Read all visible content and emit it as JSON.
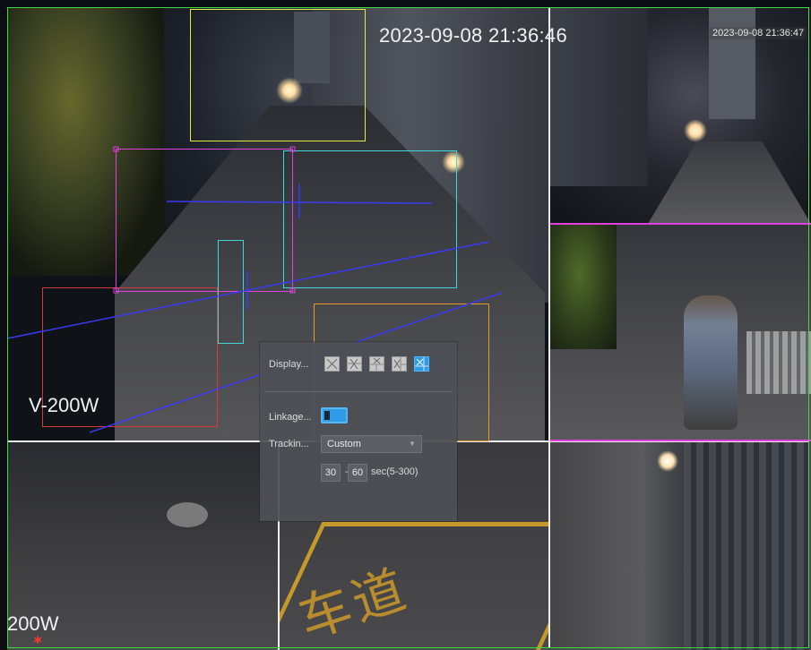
{
  "channels": {
    "main": {
      "timestamp": "2023-09-08 21:36:46",
      "label": "V-200W"
    },
    "top_right": {
      "timestamp": "2023-09-08 21:36:47"
    },
    "bottom_left": {
      "label": "200W"
    }
  },
  "dialog": {
    "display_label": "Display...",
    "layout_options": [
      "layout-1",
      "layout-2",
      "layout-3",
      "layout-4",
      "layout-5"
    ],
    "selected_layout": 5,
    "linkage_label": "Linkage...",
    "linkage_enabled": true,
    "tracking_label": "Trackin...",
    "tracking_value": "Custom",
    "duration_min": "30",
    "duration_dash": "-",
    "duration_max": "60",
    "duration_unit": "sec(5-300)"
  },
  "overlay_colors": {
    "yellow": "#e6e84a",
    "magenta": "#e040e0",
    "cyan": "#3fd8d8",
    "red": "#d83a3a",
    "orange": "#e69a30",
    "blue": "#3a3af0",
    "green": "#3fdc3f"
  }
}
